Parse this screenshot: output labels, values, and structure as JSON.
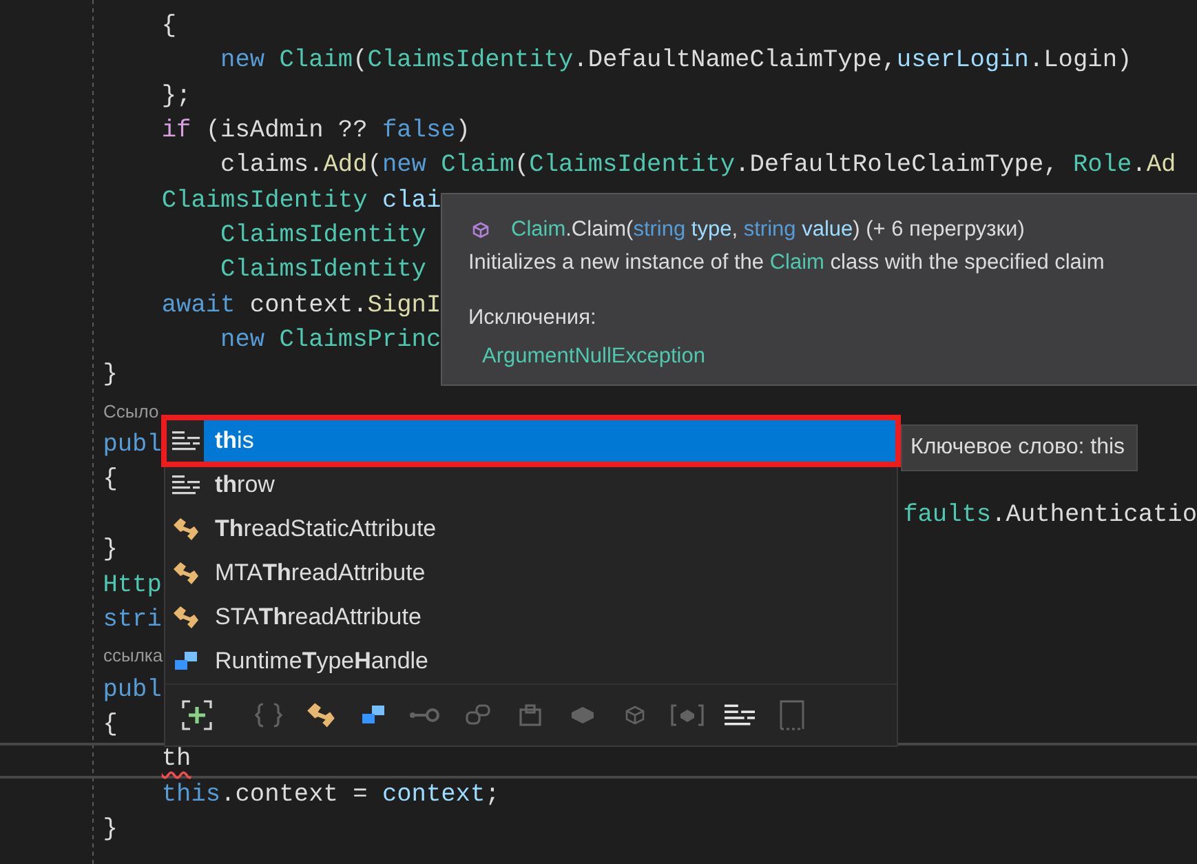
{
  "editor": {
    "lines": [
      {
        "tokens": [
          {
            "text": "        {",
            "kind": "plain"
          }
        ]
      },
      {
        "tokens": [
          {
            "text": "            new ",
            "kind": "keyword"
          },
          {
            "text": "Claim",
            "kind": "type"
          },
          {
            "text": "(",
            "kind": "plain"
          },
          {
            "text": "ClaimsIdentity",
            "kind": "type"
          },
          {
            "text": ".DefaultNameClaimType,",
            "kind": "plain"
          },
          {
            "text": "userLogin",
            "kind": "variable"
          },
          {
            "text": ".Login)",
            "kind": "plain"
          }
        ]
      },
      {
        "tokens": [
          {
            "text": "        };",
            "kind": "plain"
          }
        ]
      },
      {
        "tokens": [
          {
            "text": "        if",
            "kind": "control"
          },
          {
            "text": " (isAdmin ?? ",
            "kind": "plain"
          },
          {
            "text": "false",
            "kind": "keyword"
          },
          {
            "text": ")",
            "kind": "plain"
          }
        ]
      },
      {
        "tokens": [
          {
            "text": "            claims.",
            "kind": "plain"
          },
          {
            "text": "Add",
            "kind": "method"
          },
          {
            "text": "(",
            "kind": "plain"
          },
          {
            "text": "new ",
            "kind": "keyword"
          },
          {
            "text": "Claim",
            "kind": "type"
          },
          {
            "text": "(",
            "kind": "plain"
          },
          {
            "text": "ClaimsIdentity",
            "kind": "type"
          },
          {
            "text": ".DefaultRoleClaimType, ",
            "kind": "plain"
          },
          {
            "text": "Role",
            "kind": "type"
          },
          {
            "text": ".",
            "kind": "plain"
          },
          {
            "text": "Ad",
            "kind": "method"
          }
        ]
      },
      {
        "tokens": [
          {
            "text": "        ClaimsIdentity",
            "kind": "type"
          },
          {
            "text": " clai",
            "kind": "variable"
          }
        ]
      },
      {
        "tokens": [
          {
            "text": "            ClaimsIdentity",
            "kind": "type"
          }
        ]
      },
      {
        "tokens": [
          {
            "text": "            ClaimsIdentity",
            "kind": "type"
          }
        ]
      },
      {
        "tokens": [
          {
            "text": "        await",
            "kind": "keyword"
          },
          {
            "text": " context.",
            "kind": "plain"
          },
          {
            "text": "SignI",
            "kind": "method"
          }
        ]
      },
      {
        "tokens": [
          {
            "text": "            new ",
            "kind": "keyword"
          },
          {
            "text": "ClaimsPrinc",
            "kind": "type"
          }
        ]
      },
      {
        "tokens": [
          {
            "text": "    }",
            "kind": "plain"
          }
        ]
      },
      {
        "tokens": [
          {
            "text": "Ссыло",
            "kind": "codelens"
          }
        ]
      },
      {
        "tokens": [
          {
            "text": "    publ",
            "kind": "keyword"
          }
        ]
      },
      {
        "tokens": [
          {
            "text": "    {",
            "kind": "plain"
          }
        ]
      },
      {
        "tokens": [
          {
            "text": "faults",
            "kind": "type",
            "right": true
          },
          {
            "text": ".Authenticatio",
            "kind": "plain",
            "right": true
          }
        ]
      },
      {
        "tokens": [
          {
            "text": "    }",
            "kind": "plain"
          }
        ]
      },
      {
        "tokens": [
          {
            "text": "    Http",
            "kind": "type"
          }
        ]
      },
      {
        "tokens": [
          {
            "text": "    stri",
            "kind": "keyword"
          }
        ]
      },
      {
        "tokens": [
          {
            "text": "ссылка",
            "kind": "codelens"
          }
        ]
      },
      {
        "tokens": [
          {
            "text": "    publ",
            "kind": "keyword"
          }
        ]
      },
      {
        "tokens": [
          {
            "text": "    {",
            "kind": "plain"
          }
        ]
      },
      {
        "current": true,
        "tokens": [
          {
            "text": "        th",
            "kind": "plain",
            "error": true
          }
        ]
      },
      {
        "tokens": [
          {
            "text": "        this",
            "kind": "keyword"
          },
          {
            "text": ".context = ",
            "kind": "plain"
          },
          {
            "text": "context",
            "kind": "variable"
          },
          {
            "text": ";",
            "kind": "plain"
          }
        ]
      },
      {
        "tokens": [
          {
            "text": "    }",
            "kind": "plain"
          }
        ]
      }
    ]
  },
  "quick_info": {
    "signature": [
      {
        "text": "Claim",
        "kind": "type"
      },
      {
        "text": ".Claim(",
        "kind": "plain"
      },
      {
        "text": "string",
        "kind": "keyword"
      },
      {
        "text": " type",
        "kind": "variable"
      },
      {
        "text": ", ",
        "kind": "plain"
      },
      {
        "text": "string",
        "kind": "keyword"
      },
      {
        "text": " value",
        "kind": "variable"
      },
      {
        "text": ") (+ 6 перегрузки)",
        "kind": "plain"
      }
    ],
    "description": [
      {
        "text": "Initializes a new instance of the ",
        "kind": "plain"
      },
      {
        "text": "Claim",
        "kind": "type"
      },
      {
        "text": " class with the specified claim",
        "kind": "plain"
      }
    ],
    "exceptions_label": "Исключения:",
    "exception": "ArgumentNullException"
  },
  "completion": {
    "items": [
      {
        "label": "**th**is",
        "kind": "keyword",
        "selected": true,
        "outlined": true
      },
      {
        "label": "**th**row",
        "kind": "keyword",
        "selected": false,
        "outlined": false
      },
      {
        "label": "**Th**readStaticAttribute",
        "kind": "attribute",
        "selected": false,
        "outlined": false
      },
      {
        "label": "MTA**Th**readAttribute",
        "kind": "attribute",
        "selected": false,
        "outlined": false
      },
      {
        "label": "STA**Th**readAttribute",
        "kind": "attribute",
        "selected": false,
        "outlined": false
      },
      {
        "label": "Runtime**T**ype**H**andle",
        "kind": "struct",
        "selected": false,
        "outlined": false
      }
    ],
    "description": "Ключевое слово: this",
    "filters": [
      {
        "kind": "expand",
        "on": true
      },
      {
        "kind": "namespace",
        "on": false
      },
      {
        "kind": "attribute",
        "on": true
      },
      {
        "kind": "struct",
        "on": true
      },
      {
        "kind": "interface",
        "on": false
      },
      {
        "kind": "delegate",
        "on": false
      },
      {
        "kind": "module",
        "on": false
      },
      {
        "kind": "class",
        "on": false
      },
      {
        "kind": "cube",
        "on": false
      },
      {
        "kind": "bracket",
        "on": false
      },
      {
        "kind": "keyword",
        "on": true
      },
      {
        "kind": "snippet",
        "on": false
      }
    ]
  }
}
